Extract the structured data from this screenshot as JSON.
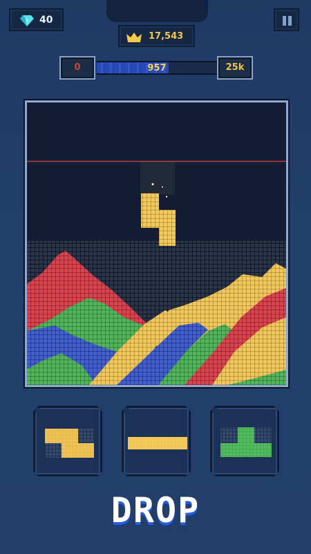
{
  "hud": {
    "gems": "40",
    "best_score": "17,543",
    "progress": {
      "start_label": "0",
      "current_label": "957",
      "end_label": "25k",
      "fraction": 0.6
    }
  },
  "board": {
    "danger_line_color": "#c0393b",
    "falling_piece": {
      "shape": "J",
      "color": "#f0c34a"
    }
  },
  "tray": {
    "pieces": [
      {
        "shape": "Z",
        "color": "#e9b944"
      },
      {
        "shape": "I",
        "color": "#f0c34a"
      },
      {
        "shape": "T",
        "color": "#3fae4d"
      }
    ]
  },
  "title": "DROP",
  "colors": {
    "red": "#d6303f",
    "green": "#3fae4d",
    "blue": "#2f4fc8",
    "yellow": "#f0c34a"
  }
}
